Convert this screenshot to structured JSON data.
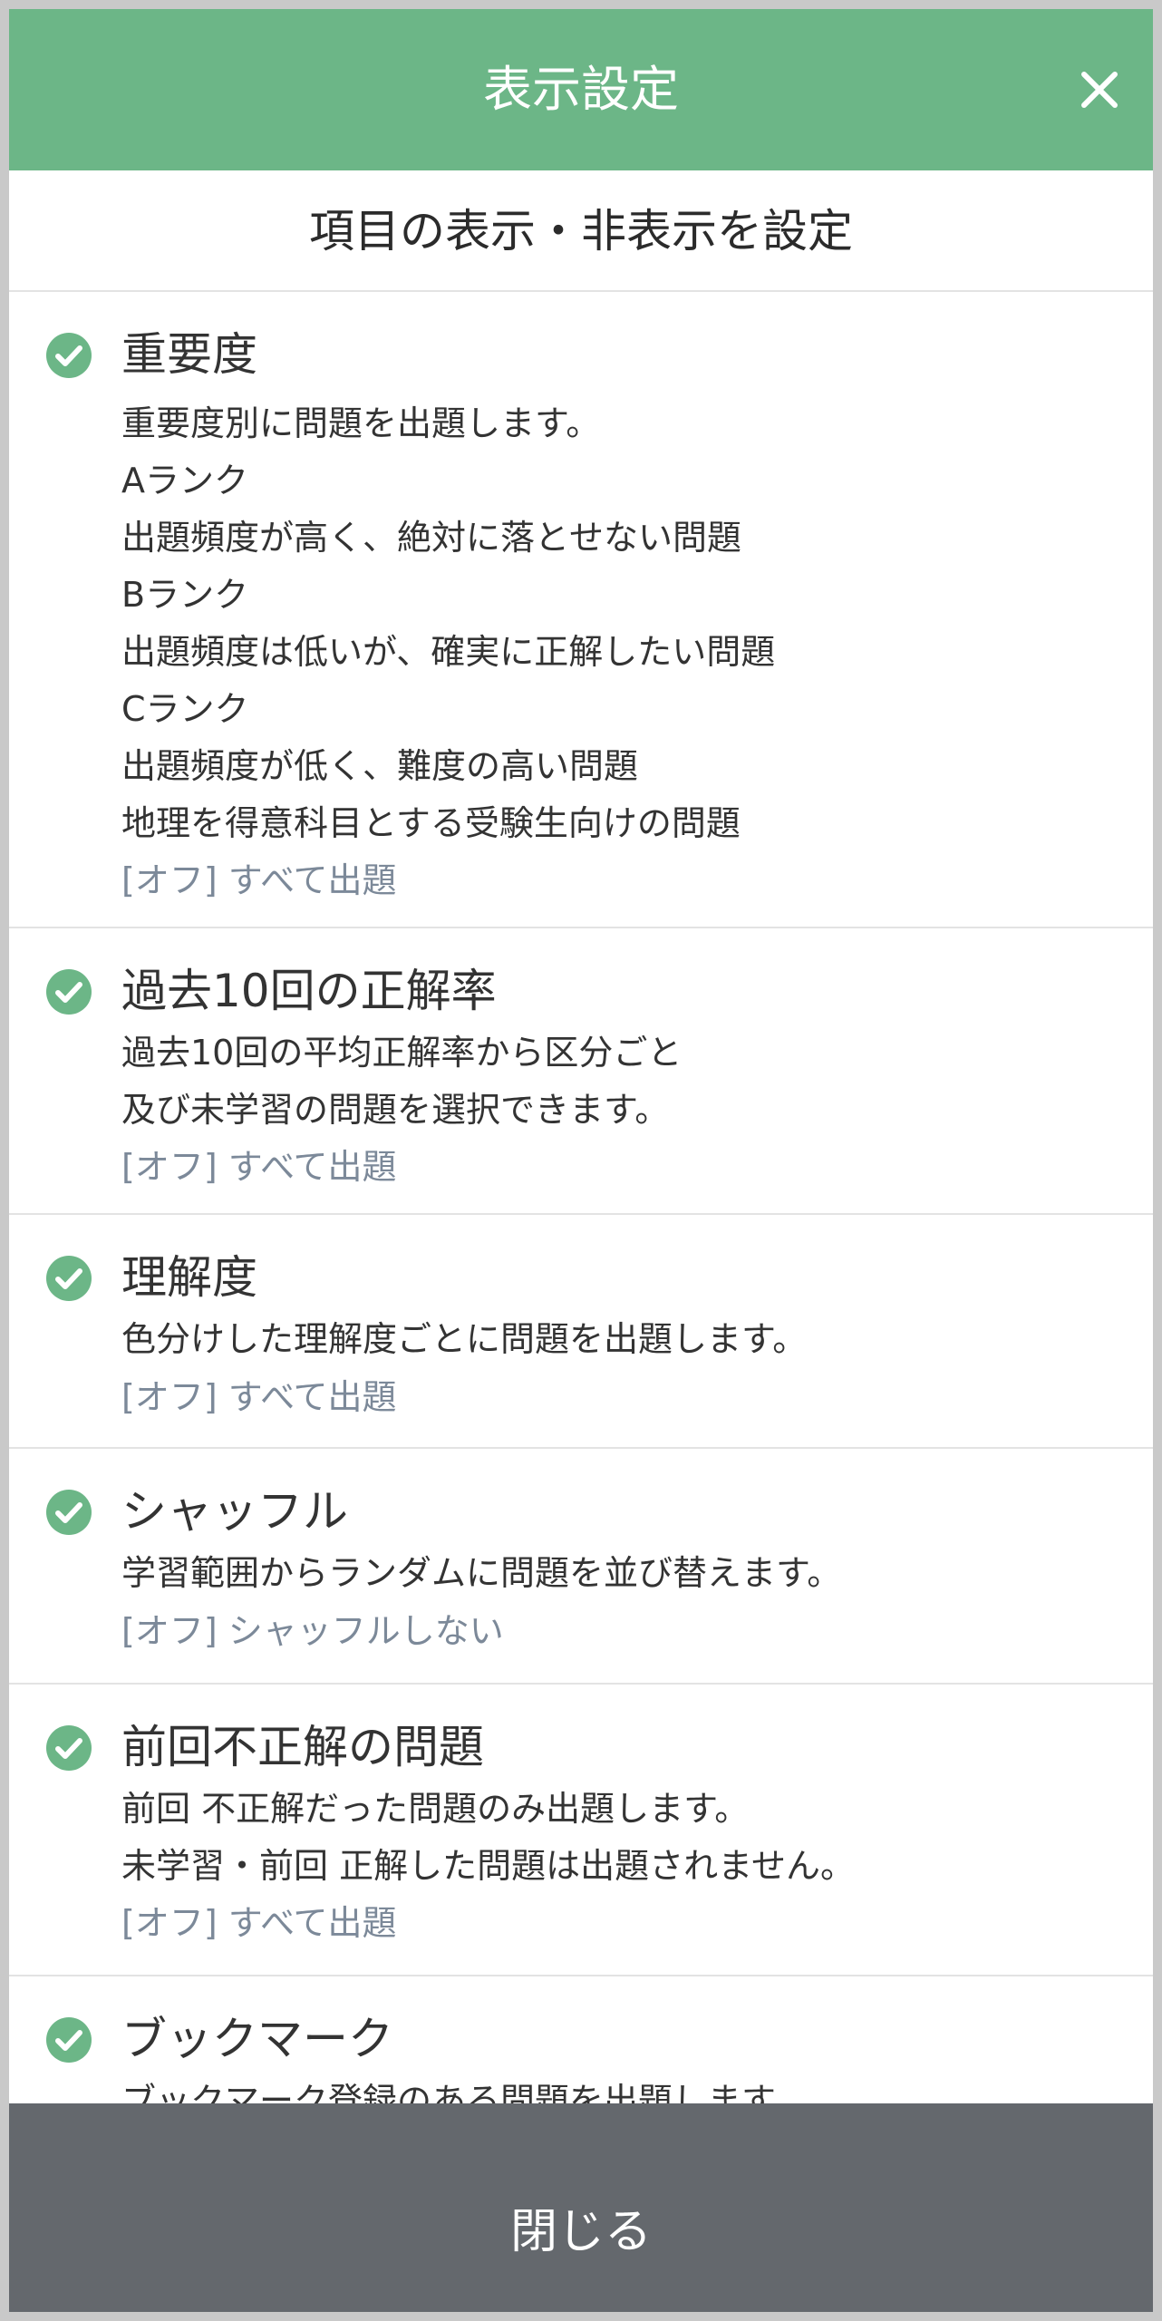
{
  "header": {
    "title": "表示設定",
    "close_icon": "close-icon"
  },
  "subheader": {
    "title": "項目の表示・非表示を設定"
  },
  "colors": {
    "header_bg": "#6cb687",
    "check": "#6cb687",
    "footer_bg": "#64686d",
    "status_text": "#7c8999"
  },
  "items": [
    {
      "title": "重要度",
      "lines": [
        "重要度別に問題を出題します。",
        "Aランク",
        "出題頻度が高く、絶対に落とせない問題",
        "Bランク",
        "出題頻度は低いが、確実に正解したい問題",
        "Cランク",
        "出題頻度が低く、難度の高い問題",
        "地理を得意科目とする受験生向けの問題"
      ],
      "status": "[オフ] すべて出題",
      "checked": true
    },
    {
      "title": "過去10回の正解率",
      "lines": [
        "過去10回の平均正解率から区分ごと",
        "及び未学習の問題を選択できます。"
      ],
      "status": "[オフ] すべて出題",
      "checked": true
    },
    {
      "title": "理解度",
      "lines": [
        "色分けした理解度ごとに問題を出題します。"
      ],
      "status": "[オフ] すべて出題",
      "checked": true
    },
    {
      "title": "シャッフル",
      "lines": [
        "学習範囲からランダムに問題を並び替えます。"
      ],
      "status": "[オフ] シャッフルしない",
      "checked": true
    },
    {
      "title": "前回不正解の問題",
      "lines": [
        "前回 不正解だった問題のみ出題します。",
        "未学習・前回 正解した問題は出題されません。"
      ],
      "status": "[オフ] すべて出題",
      "checked": true
    },
    {
      "title": "ブックマーク",
      "lines": [
        "ブックマーク登録のある問題を出題します。"
      ],
      "status": "",
      "checked": true
    }
  ],
  "footer": {
    "close_label": "閉じる"
  }
}
